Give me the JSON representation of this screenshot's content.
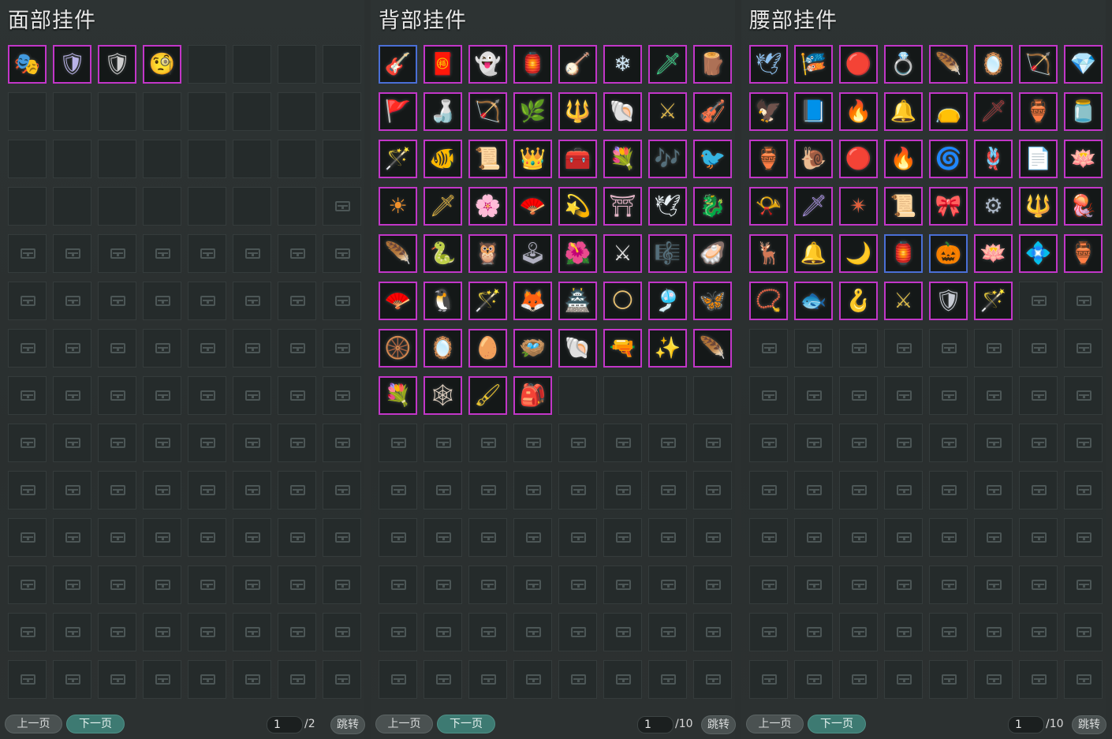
{
  "panels": [
    {
      "title": "面部挂件",
      "items": [
        {
          "icon": "face-mask-icon",
          "glyph": "🎭",
          "color": "#d84a4a",
          "frame": "purple"
        },
        {
          "icon": "silver-helmet-mask-icon",
          "glyph": "🛡",
          "color": "#b9b3e8",
          "frame": "purple"
        },
        {
          "icon": "shield-mask-icon",
          "glyph": "🛡",
          "color": "#d0d0d0",
          "frame": "purple"
        },
        {
          "icon": "monocle-icon",
          "glyph": "🧐",
          "color": "#e3b43a",
          "frame": "purple"
        }
      ],
      "empty_unlocked": 27,
      "total_slots": 112,
      "footer": {
        "prev": "上一页",
        "next": "下一页",
        "page": "1",
        "total": "/2",
        "jump": "跳转"
      }
    },
    {
      "title": "背部挂件",
      "items": [
        {
          "icon": "golden-instrument-icon",
          "glyph": "🎸",
          "color": "#e1a93c",
          "frame": "blue"
        },
        {
          "icon": "red-scroll-case-icon",
          "glyph": "🧧",
          "color": "#d84a3a",
          "frame": "purple"
        },
        {
          "icon": "blue-spirit-icon",
          "glyph": "👻",
          "color": "#7cb6f0",
          "frame": "purple"
        },
        {
          "icon": "flower-lantern-icon",
          "glyph": "🏮",
          "color": "#d6455a",
          "frame": "purple"
        },
        {
          "icon": "golden-lyre-icon",
          "glyph": "🪕",
          "color": "#d7a33e",
          "frame": "purple"
        },
        {
          "icon": "ice-wings-icon",
          "glyph": "❄",
          "color": "#cfe6f5",
          "frame": "purple"
        },
        {
          "icon": "jade-sword-icon",
          "glyph": "🗡",
          "color": "#3fd68c",
          "frame": "purple"
        },
        {
          "icon": "wooden-case-icon",
          "glyph": "🪵",
          "color": "#a4553d",
          "frame": "purple"
        },
        {
          "icon": "red-banner-icon",
          "glyph": "🚩",
          "color": "#d23c2c",
          "frame": "purple"
        },
        {
          "icon": "wine-gourd-icon",
          "glyph": "🍶",
          "color": "#e9e4d8",
          "frame": "purple"
        },
        {
          "icon": "golden-bow-icon",
          "glyph": "🏹",
          "color": "#d7aa48",
          "frame": "purple"
        },
        {
          "icon": "golden-fan-icon",
          "glyph": "🌿",
          "color": "#d4b23a",
          "frame": "purple"
        },
        {
          "icon": "ornate-staff-icon",
          "glyph": "🔱",
          "color": "#c8aa52",
          "frame": "purple"
        },
        {
          "icon": "shell-ornament-icon",
          "glyph": "🐚",
          "color": "#c4c8dc",
          "frame": "purple"
        },
        {
          "icon": "golden-blade-icon",
          "glyph": "⚔",
          "color": "#d8b248",
          "frame": "purple"
        },
        {
          "icon": "golden-lute-icon",
          "glyph": "🎻",
          "color": "#e2c25a",
          "frame": "purple"
        },
        {
          "icon": "golden-spear-icon",
          "glyph": "🪄",
          "color": "#d2a03c",
          "frame": "purple"
        },
        {
          "icon": "fishbowl-icon",
          "glyph": "🐠",
          "color": "#8cc6e6",
          "frame": "purple"
        },
        {
          "icon": "golden-scroll-icon",
          "glyph": "📜",
          "color": "#d4b24a",
          "frame": "purple"
        },
        {
          "icon": "golden-crown-wings-icon",
          "glyph": "👑",
          "color": "#d79a36",
          "frame": "purple"
        },
        {
          "icon": "red-treasure-chest-icon",
          "glyph": "🧰",
          "color": "#c8303a",
          "frame": "purple"
        },
        {
          "icon": "blue-flowers-icon",
          "glyph": "💐",
          "color": "#9cc4f4",
          "frame": "purple"
        },
        {
          "icon": "flute-icon",
          "glyph": "🎶",
          "color": "#d8dee6",
          "frame": "purple"
        },
        {
          "icon": "bird-icon",
          "glyph": "🐦",
          "color": "#8c5a4e",
          "frame": "purple"
        },
        {
          "icon": "sun-orb-icon",
          "glyph": "☀",
          "color": "#f0902a",
          "frame": "purple"
        },
        {
          "icon": "golden-sword-icon",
          "glyph": "🗡",
          "color": "#e2b440",
          "frame": "purple"
        },
        {
          "icon": "white-flowers-icon",
          "glyph": "🌸",
          "color": "#e8e8e8",
          "frame": "purple"
        },
        {
          "icon": "white-fan-icon",
          "glyph": "🪭",
          "color": "#d8e8e0",
          "frame": "purple"
        },
        {
          "icon": "golden-ring-icon",
          "glyph": "💫",
          "color": "#e4c650",
          "frame": "purple"
        },
        {
          "icon": "flower-arch-icon",
          "glyph": "⛩",
          "color": "#e6b6c8",
          "frame": "purple"
        },
        {
          "icon": "white-crane-icon",
          "glyph": "🕊",
          "color": "#e8f0f4",
          "frame": "purple"
        },
        {
          "icon": "golden-dragon-icon",
          "glyph": "🐉",
          "color": "#d4a23a",
          "frame": "purple"
        },
        {
          "icon": "red-feather-icon",
          "glyph": "🪶",
          "color": "#d03c2c",
          "frame": "purple"
        },
        {
          "icon": "white-serpent-icon",
          "glyph": "🐍",
          "color": "#c8c4b8",
          "frame": "purple"
        },
        {
          "icon": "owl-mask-icon",
          "glyph": "🦉",
          "color": "#b8c4dc",
          "frame": "purple"
        },
        {
          "icon": "game-console-icon",
          "glyph": "🕹",
          "color": "#b0b0c0",
          "frame": "purple"
        },
        {
          "icon": "red-branch-icon",
          "glyph": "🌺",
          "color": "#d05a4a",
          "frame": "purple"
        },
        {
          "icon": "silver-swords-icon",
          "glyph": "⚔",
          "color": "#e0e0e0",
          "frame": "purple"
        },
        {
          "icon": "pipa-instrument-icon",
          "glyph": "🎼",
          "color": "#e6e6e6",
          "frame": "purple"
        },
        {
          "icon": "pearl-shell-icon",
          "glyph": "🦪",
          "color": "#c8d4e6",
          "frame": "purple"
        },
        {
          "icon": "red-paper-fan-icon",
          "glyph": "🪭",
          "color": "#e2503c",
          "frame": "purple"
        },
        {
          "icon": "penguin-icon",
          "glyph": "🐧",
          "color": "#e29a3a",
          "frame": "purple"
        },
        {
          "icon": "dark-staff-icon",
          "glyph": "🪄",
          "color": "#8c8c8c",
          "frame": "purple"
        },
        {
          "icon": "fox-lantern-icon",
          "glyph": "🦊",
          "color": "#d25a48",
          "frame": "purple"
        },
        {
          "icon": "pagoda-icon",
          "glyph": "🏯",
          "color": "#c87a4a",
          "frame": "purple"
        },
        {
          "icon": "round-fan-icon",
          "glyph": "🌕",
          "color": "#e8c070",
          "frame": "purple"
        },
        {
          "icon": "teal-tassel-icon",
          "glyph": "🎐",
          "color": "#6ed0c4",
          "frame": "purple"
        },
        {
          "icon": "dark-wings-icon",
          "glyph": "🦋",
          "color": "#8ca4e8",
          "frame": "purple"
        },
        {
          "icon": "silver-cart-icon",
          "glyph": "🛞",
          "color": "#d0d4dc",
          "frame": "purple"
        },
        {
          "icon": "crystal-mirror-icon",
          "glyph": "🪞",
          "color": "#cfe6ef",
          "frame": "purple"
        },
        {
          "icon": "jade-egg-icon",
          "glyph": "🥚",
          "color": "#e0e2b0",
          "frame": "purple"
        },
        {
          "icon": "bird-cage-icon",
          "glyph": "🪺",
          "color": "#c47a3a",
          "frame": "purple"
        },
        {
          "icon": "drill-horn-icon",
          "glyph": "🐚",
          "color": "#c49a46",
          "frame": "purple"
        },
        {
          "icon": "silver-pistol-icon",
          "glyph": "🔫",
          "color": "#c0c8d4",
          "frame": "purple"
        },
        {
          "icon": "golden-wand-icon",
          "glyph": "✨",
          "color": "#d8b040",
          "frame": "purple"
        },
        {
          "icon": "feather-plume-icon",
          "glyph": "🪶",
          "color": "#d8d0c0",
          "frame": "purple"
        },
        {
          "icon": "flower-bouquet-icon",
          "glyph": "💐",
          "color": "#e4a0c0",
          "frame": "purple"
        },
        {
          "icon": "dreamcatcher-icon",
          "glyph": "🕸",
          "color": "#e0d0c0",
          "frame": "purple"
        },
        {
          "icon": "golden-brush-icon",
          "glyph": "🖌",
          "color": "#e8c230",
          "frame": "purple"
        },
        {
          "icon": "blue-backpack-icon",
          "glyph": "🎒",
          "color": "#4a7ad8",
          "frame": "purple"
        }
      ],
      "empty_unlocked": 4,
      "total_slots": 112,
      "footer": {
        "prev": "上一页",
        "next": "下一页",
        "page": "1",
        "total": "/10",
        "jump": "跳转"
      }
    },
    {
      "title": "腰部挂件",
      "items": [
        {
          "icon": "blue-bird-charm-icon",
          "glyph": "🕊",
          "color": "#8cc0f0",
          "frame": "purple"
        },
        {
          "icon": "red-tassel-charm-icon",
          "glyph": "🎏",
          "color": "#d4403c",
          "frame": "purple"
        },
        {
          "icon": "ruby-medallion-icon",
          "glyph": "🔴",
          "color": "#d8343a",
          "frame": "purple"
        },
        {
          "icon": "jade-ring-icon",
          "glyph": "💍",
          "color": "#5cd0b8",
          "frame": "purple"
        },
        {
          "icon": "white-feather-ball-icon",
          "glyph": "🪶",
          "color": "#e8ece4",
          "frame": "purple"
        },
        {
          "icon": "red-mirror-icon",
          "glyph": "🪞",
          "color": "#c8343a",
          "frame": "purple"
        },
        {
          "icon": "golden-arrows-icon",
          "glyph": "🏹",
          "color": "#d6b24a",
          "frame": "purple"
        },
        {
          "icon": "gem-pendant-icon",
          "glyph": "💎",
          "color": "#e8c84a",
          "frame": "purple"
        },
        {
          "icon": "iron-claw-icon",
          "glyph": "🦅",
          "color": "#b0a49a",
          "frame": "purple"
        },
        {
          "icon": "blue-scroll-icon",
          "glyph": "📘",
          "color": "#4a8ae0",
          "frame": "purple"
        },
        {
          "icon": "pipe-tassel-icon",
          "glyph": "🔥",
          "color": "#e07a3a",
          "frame": "purple"
        },
        {
          "icon": "golden-bell-icon",
          "glyph": "🔔",
          "color": "#e2b03c",
          "frame": "purple"
        },
        {
          "icon": "white-pouch-icon",
          "glyph": "👝",
          "color": "#e8e8ec",
          "frame": "purple"
        },
        {
          "icon": "dark-blade-icon",
          "glyph": "🗡",
          "color": "#a43a3a",
          "frame": "purple"
        },
        {
          "icon": "golden-pot-icon",
          "glyph": "🏺",
          "color": "#d8ac46",
          "frame": "purple"
        },
        {
          "icon": "pearl-jar-icon",
          "glyph": "🫙",
          "color": "#e2ce94",
          "frame": "purple"
        },
        {
          "icon": "teal-gourd-icon",
          "glyph": "🏺",
          "color": "#5a9ab0",
          "frame": "purple"
        },
        {
          "icon": "spiral-shell-icon",
          "glyph": "🐌",
          "color": "#e0b860",
          "frame": "purple"
        },
        {
          "icon": "red-golden-ball-icon",
          "glyph": "🔴",
          "color": "#c83a2a",
          "frame": "purple"
        },
        {
          "icon": "phoenix-feather-icon",
          "glyph": "🔥",
          "color": "#e0783a",
          "frame": "purple"
        },
        {
          "icon": "blue-horn-icon",
          "glyph": "🌀",
          "color": "#5a7ae0",
          "frame": "purple"
        },
        {
          "icon": "bronze-whip-icon",
          "glyph": "🪢",
          "color": "#b4683a",
          "frame": "purple"
        },
        {
          "icon": "white-paper-charm-icon",
          "glyph": "📄",
          "color": "#e8e8e8",
          "frame": "purple"
        },
        {
          "icon": "lotus-lamp-icon",
          "glyph": "🪷",
          "color": "#d8aa48",
          "frame": "purple"
        },
        {
          "icon": "golden-horn-icon",
          "glyph": "📯",
          "color": "#d8b048",
          "frame": "purple"
        },
        {
          "icon": "violet-sword-icon",
          "glyph": "🗡",
          "color": "#a890e0",
          "frame": "purple"
        },
        {
          "icon": "red-star-flower-icon",
          "glyph": "✴",
          "color": "#e2603c",
          "frame": "purple"
        },
        {
          "icon": "scroll-bundle-icon",
          "glyph": "📜",
          "color": "#d6c8b0",
          "frame": "purple"
        },
        {
          "icon": "golden-bow-charm-icon",
          "glyph": "🎀",
          "color": "#d0a848",
          "frame": "purple"
        },
        {
          "icon": "silver-mech-icon",
          "glyph": "⚙",
          "color": "#a8b4c4",
          "frame": "purple"
        },
        {
          "icon": "silver-trident-icon",
          "glyph": "🔱",
          "color": "#c8d0d8",
          "frame": "purple"
        },
        {
          "icon": "jellyfish-icon",
          "glyph": "🪼",
          "color": "#a0c0f0",
          "frame": "purple"
        },
        {
          "icon": "golden-antler-icon",
          "glyph": "🦌",
          "color": "#d8a840",
          "frame": "purple"
        },
        {
          "icon": "silver-bells-icon",
          "glyph": "🔔",
          "color": "#d8d8d8",
          "frame": "purple"
        },
        {
          "icon": "moon-charm-icon",
          "glyph": "🌙",
          "color": "#e0e4ec",
          "frame": "purple"
        },
        {
          "icon": "lantern-charm-icon",
          "glyph": "🏮",
          "color": "#c8ccd8",
          "frame": "blue"
        },
        {
          "icon": "orange-mask-icon",
          "glyph": "🎃",
          "color": "#e0842a",
          "frame": "blue"
        },
        {
          "icon": "white-lotus-icon",
          "glyph": "🪷",
          "color": "#e6ece0",
          "frame": "purple"
        },
        {
          "icon": "crystal-pouch-icon",
          "glyph": "💠",
          "color": "#cde4ec",
          "frame": "purple"
        },
        {
          "icon": "bronze-pot-icon",
          "glyph": "🏺",
          "color": "#c0a070",
          "frame": "purple"
        },
        {
          "icon": "golden-beads-icon",
          "glyph": "📿",
          "color": "#e0b040",
          "frame": "purple"
        },
        {
          "icon": "golden-fish-charm-icon",
          "glyph": "🐟",
          "color": "#d2b068",
          "frame": "purple"
        },
        {
          "icon": "golden-hook-icon",
          "glyph": "🪝",
          "color": "#e6c870",
          "frame": "purple"
        },
        {
          "icon": "golden-cross-blade-icon",
          "glyph": "⚔",
          "color": "#d8b848",
          "frame": "purple"
        },
        {
          "icon": "silver-gauntlet-icon",
          "glyph": "🛡",
          "color": "#c8ccd4",
          "frame": "purple"
        },
        {
          "icon": "golden-staff-icon",
          "glyph": "🪄",
          "color": "#d09a3a",
          "frame": "purple"
        }
      ],
      "empty_unlocked": 0,
      "total_slots": 112,
      "footer": {
        "prev": "上一页",
        "next": "下一页",
        "page": "1",
        "total": "/10",
        "jump": "跳转"
      }
    }
  ]
}
